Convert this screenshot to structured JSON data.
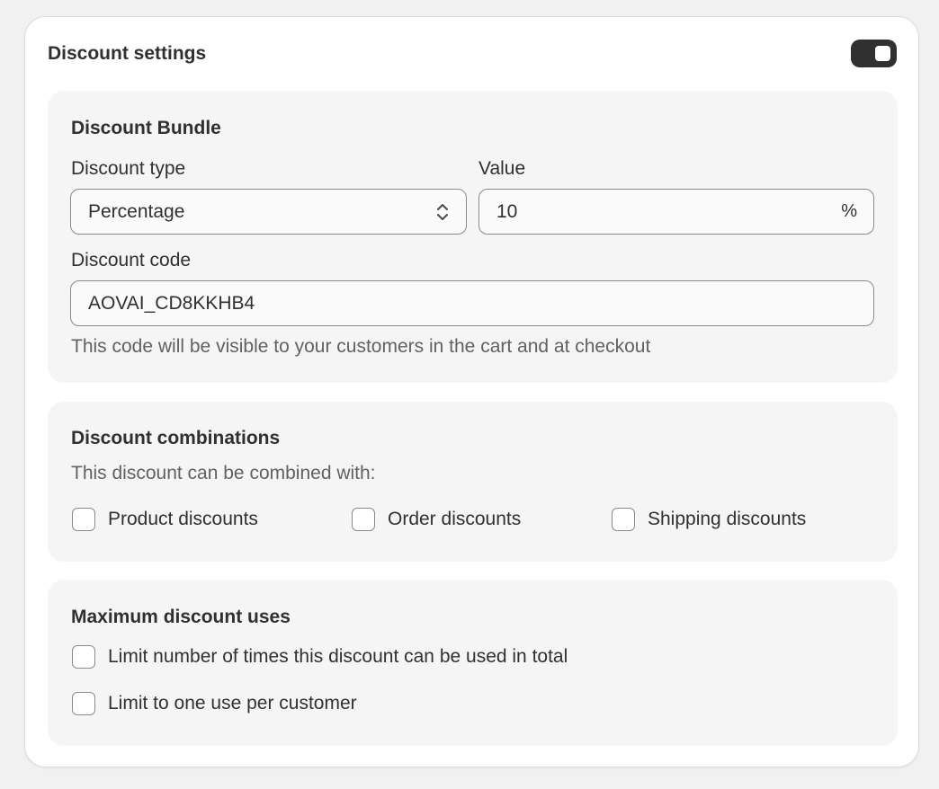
{
  "card": {
    "title": "Discount settings",
    "toggle_state": "on"
  },
  "bundle": {
    "title": "Discount Bundle",
    "discount_type_label": "Discount type",
    "discount_type_value": "Percentage",
    "value_label": "Value",
    "value": "10",
    "value_suffix": "%",
    "code_label": "Discount code",
    "code_value": "AOVAI_CD8KKHB4",
    "code_help": "This code will be visible to your customers in the cart and at checkout"
  },
  "combinations": {
    "title": "Discount combinations",
    "subtitle": "This discount can be combined with:",
    "options": [
      {
        "label": "Product discounts",
        "checked": false
      },
      {
        "label": "Order discounts",
        "checked": false
      },
      {
        "label": "Shipping discounts",
        "checked": false
      }
    ]
  },
  "max_uses": {
    "title": "Maximum discount uses",
    "options": [
      {
        "label": "Limit number of times this discount can be used in total",
        "checked": false
      },
      {
        "label": "Limit to one use per customer",
        "checked": false
      }
    ]
  },
  "colors": {
    "background": "#f1f1f1",
    "card": "#ffffff",
    "section": "#f5f5f5",
    "toggle_on": "#303030",
    "text": "#303030",
    "muted_text": "#616161"
  }
}
